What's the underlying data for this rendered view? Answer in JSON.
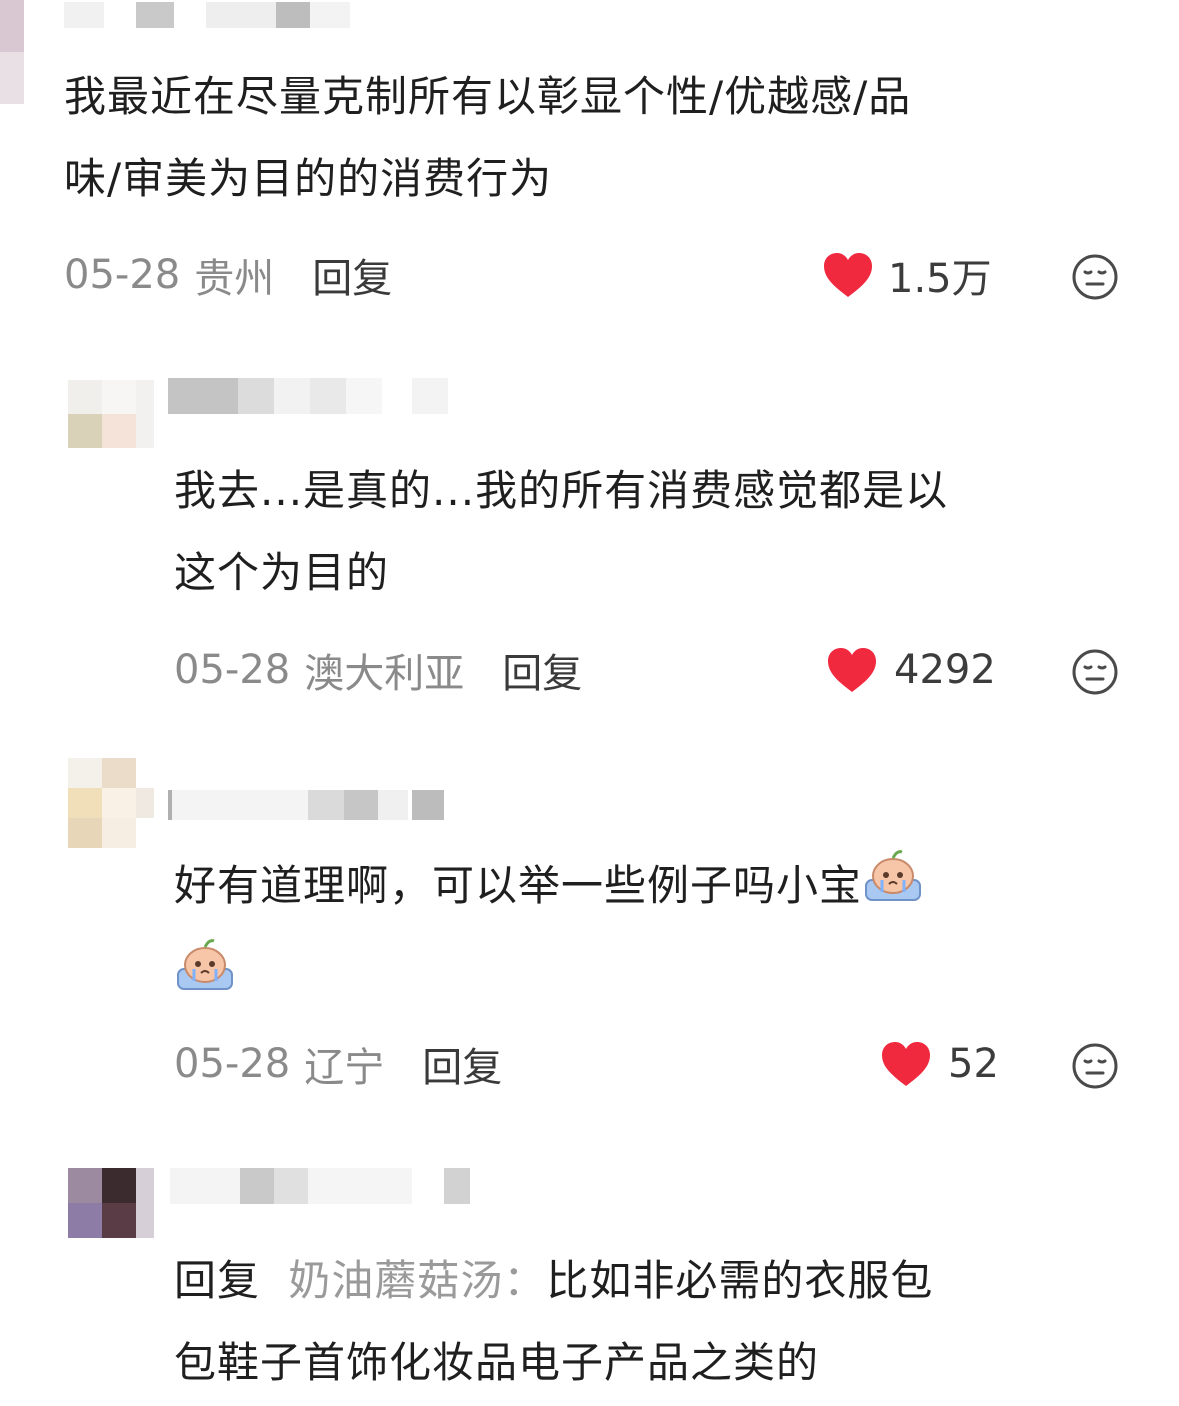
{
  "comments": [
    {
      "text": "我最近在尽量克制所有以彰显个性/优越感/品味/审美为目的的消费行为",
      "line1": "我最近在尽量克制所有以彰显个性/优越感/品",
      "line2": "味/审美为目的的消费行为",
      "date": "05-28",
      "location": "贵州",
      "reply_label": "回复",
      "likes": "1.5万"
    },
    {
      "line1": "我去...是真的...我的所有消费感觉都是以",
      "line2": "这个为目的",
      "date": "05-28",
      "location": "澳大利亚",
      "reply_label": "回复",
      "likes": "4292"
    },
    {
      "line1": "好有道理啊，可以举一些例子吗小宝",
      "date": "05-28",
      "location": "辽宁",
      "reply_label": "回复",
      "likes": "52",
      "emoji": "crying-peach-emoji"
    },
    {
      "reply_prefix": "回复",
      "reply_to": "奶油蘑菇汤：",
      "line1_rest": "比如非必需的衣服包",
      "line2": "包鞋子首饰化妆品电子产品之类的"
    }
  ],
  "icons": {
    "like": "heart-icon",
    "dislike": "neutral-face-icon"
  },
  "colors": {
    "heart": "#f0293f",
    "meta_gray": "#8a8a8a"
  }
}
